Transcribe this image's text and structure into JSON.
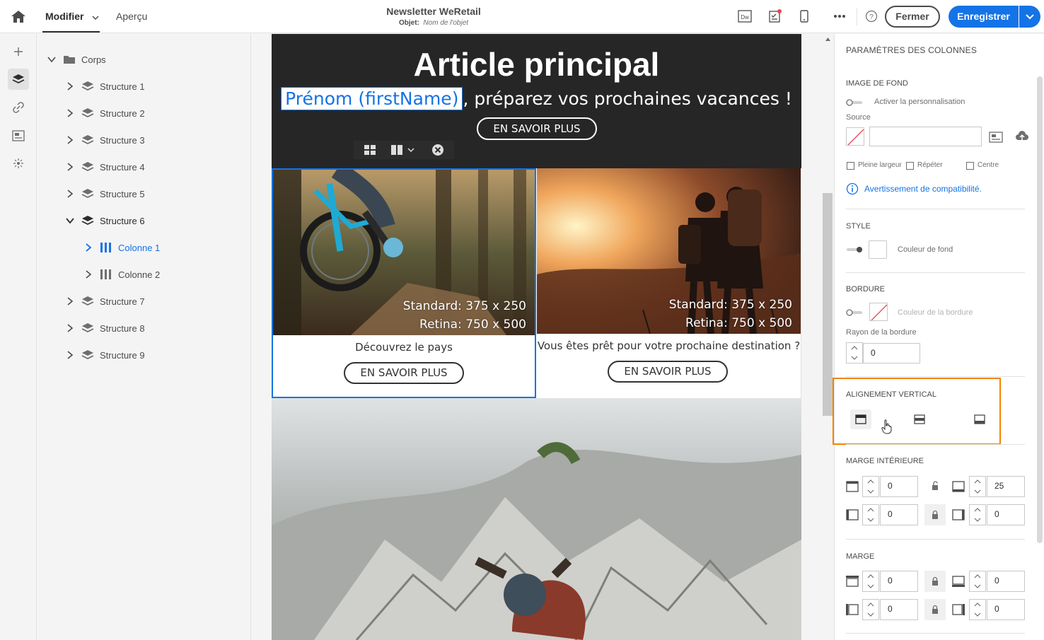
{
  "header": {
    "tabs": [
      {
        "label": "Modifier"
      },
      {
        "label": "Aperçu"
      }
    ],
    "doc_title": "Newsletter WeRetail",
    "subject_label": "Objet:",
    "subject_value": "Nom de l'objet",
    "close_label": "Fermer",
    "save_label": "Enregistrer",
    "icons": [
      "home-icon",
      "chevron-down-icon",
      "dreamweaver-icon",
      "checklist-icon",
      "mobile-icon",
      "more-icon",
      "help-icon"
    ]
  },
  "tree": {
    "root": "Corps",
    "items": [
      {
        "label": "Structure 1"
      },
      {
        "label": "Structure 2"
      },
      {
        "label": "Structure 3"
      },
      {
        "label": "Structure 4"
      },
      {
        "label": "Structure 5"
      },
      {
        "label": "Structure 6"
      },
      {
        "label": "Colonne 1"
      },
      {
        "label": "Colonne 2"
      },
      {
        "label": "Structure 7"
      },
      {
        "label": "Structure 8"
      },
      {
        "label": "Structure 9"
      }
    ]
  },
  "email": {
    "hero_title": "Article principal",
    "perso_field": "Prénom (firstName)",
    "hero_line_rest": ", préparez vos prochaines vacances !",
    "hero_button": "EN SAVOIR PLUS",
    "col1": {
      "caption_line1": "Standard: 375 x 250",
      "caption_line2": "Retina: 750 x 500",
      "text": "Découvrez le pays",
      "button": "EN SAVOIR PLUS"
    },
    "col2": {
      "caption_line1": "Standard: 375 x 250",
      "caption_line2": "Retina: 750 x 500",
      "text": "Vous êtes prêt pour votre prochaine destination ?",
      "button": "EN SAVOIR PLUS"
    }
  },
  "panel": {
    "title": "PARAMÈTRES DES COLONNES",
    "bg_image": {
      "label": "IMAGE DE FOND",
      "personalize": "Activer la personnalisation",
      "source_label": "Source",
      "source_value": "",
      "full_width": "Pleine largeur",
      "repeat": "Répéter",
      "center": "Centre",
      "compat_warning": "Avertissement de compatibilité."
    },
    "style": {
      "label": "STYLE",
      "bg_color_label": "Couleur de fond"
    },
    "border": {
      "label": "BORDURE",
      "color_label": "Couleur de la bordure",
      "radius_label": "Rayon de la bordure",
      "radius_value": "0"
    },
    "valign": {
      "label": "ALIGNEMENT VERTICAL"
    },
    "padding": {
      "label": "MARGE INTÉRIEURE",
      "top": "0",
      "bottom": "25",
      "left": "0",
      "right": "0"
    },
    "margin": {
      "label": "MARGE",
      "top": "0",
      "bottom": "0",
      "left": "0",
      "right": "0"
    }
  },
  "colors": {
    "accent": "#1473e6",
    "highlight": "#f28500",
    "hero_bg": "#262626"
  }
}
